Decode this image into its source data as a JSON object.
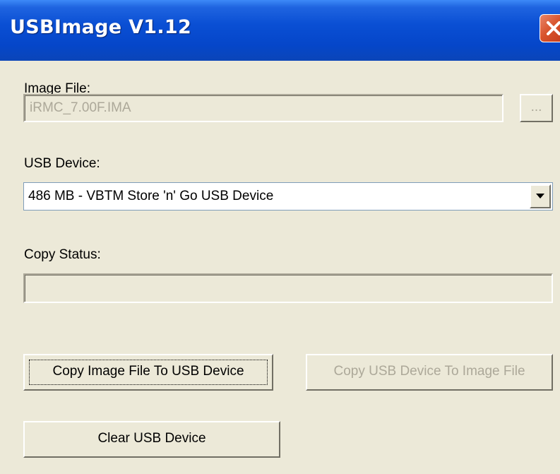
{
  "window": {
    "title": "USBImage V1.12"
  },
  "image_file": {
    "label": "Image File:",
    "value": "iRMC_7.00F.IMA",
    "browse_label": "..."
  },
  "usb_device": {
    "label": "USB Device:",
    "selected": "486 MB - VBTM Store 'n' Go USB Device"
  },
  "copy_status": {
    "label": "Copy Status:",
    "progress": 0
  },
  "buttons": {
    "copy_to_usb": "Copy Image File To USB Device",
    "copy_to_image": "Copy USB Device To Image File",
    "clear_usb": "Clear USB Device"
  },
  "colors": {
    "titlebar": "#0a4fd4",
    "dialog_bg": "#ece9d8",
    "close_button": "#d8532c",
    "disabled_text": "#aca899"
  },
  "icons": {
    "close": "close-icon",
    "dropdown": "chevron-down-icon"
  }
}
